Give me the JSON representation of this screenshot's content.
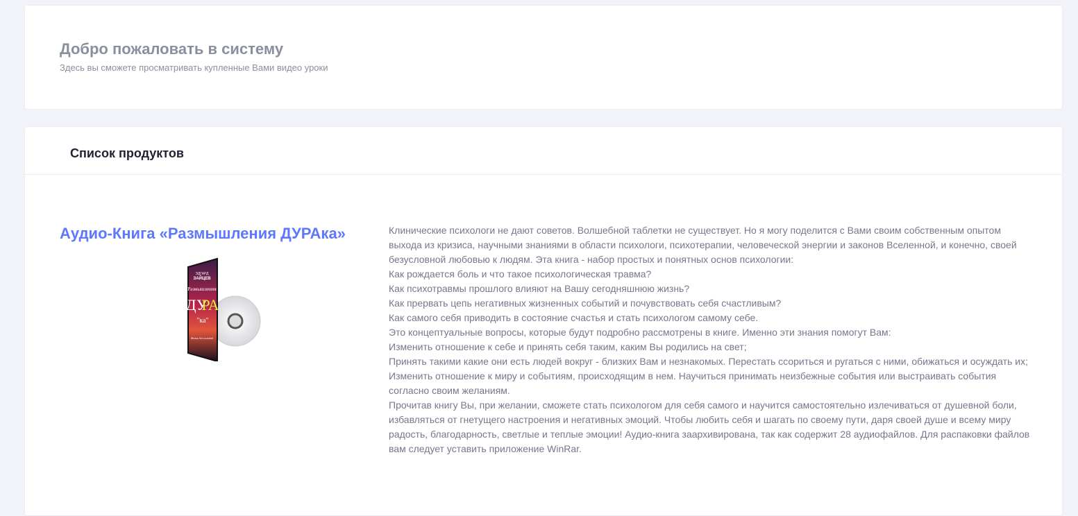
{
  "welcome": {
    "title": "Добро пожаловать в систему",
    "subtitle": "Здесь вы сможете просматривать купленные Вами видео уроки"
  },
  "products": {
    "heading": "Список продуктов",
    "items": [
      {
        "title": "Аудио-Книга «Размышления ДУРАка»",
        "cover_text": {
          "author_first": "ЭДГАРД",
          "author_last": "ЗАЙЦЕВ",
          "word": "Размышления",
          "big": "ДУРА",
          "suffix": "\"ка\"",
          "tagline": "Жизнь без иллюзий"
        },
        "description": [
          "Клинические психологи не дают советов. Волшебной таблетки не существует. Но я могу поделится с Вами своим собственным опытом выхода из кризиса, научными знаниями в области психологи, психотерапии, человеческой энергии и законов Вселенной, и конечно, своей безусловной любовью к людям. Эта книга - набор простых и понятных основ психологии:",
          "Как рождается боль и что такое психологическая травма?",
          "Как психотравмы прошлого влияют на Вашу сегодняшнюю жизнь?",
          "Как прервать цепь негативных жизненных событий и почувствовать себя счастливым?",
          "Как самого себя приводить в состояние счастья и стать психологом самому себе.",
          "Это концептуальные вопросы, которые будут подробно рассмотрены в книге. Именно эти знания помогут Вам:",
          "Изменить отношение к себе и принять себя таким, каким Вы родились на свет;",
          "Принять такими какие они есть людей вокруг - близких Вам и незнакомых. Перестать ссориться и ругаться с ними, обижаться и осуждать их;",
          "Изменить отношение к миру и событиям, происходящим в нем. Научиться принимать неизбежные события или выстраивать события согласно своим желаниям.",
          "Прочитав книгу Вы, при желании, сможете стать психологом для себя самого и научится самостоятельно излечиваться от душевной боли, избавляться от гнетущего настроения и негативных эмоций. Чтобы любить себя и шагать по своему пути, даря своей душе и всему миру радость, благодарность, светлые и теплые эмоции! Аудио-книга заархивирована, так как содержит 28 аудиофайлов. Для распаковки файлов вам следует уставить приложение WinRar."
        ]
      }
    ]
  },
  "colors": {
    "accent": "#5d78ff",
    "text_muted": "#74788d",
    "background": "#f2f3f8"
  }
}
